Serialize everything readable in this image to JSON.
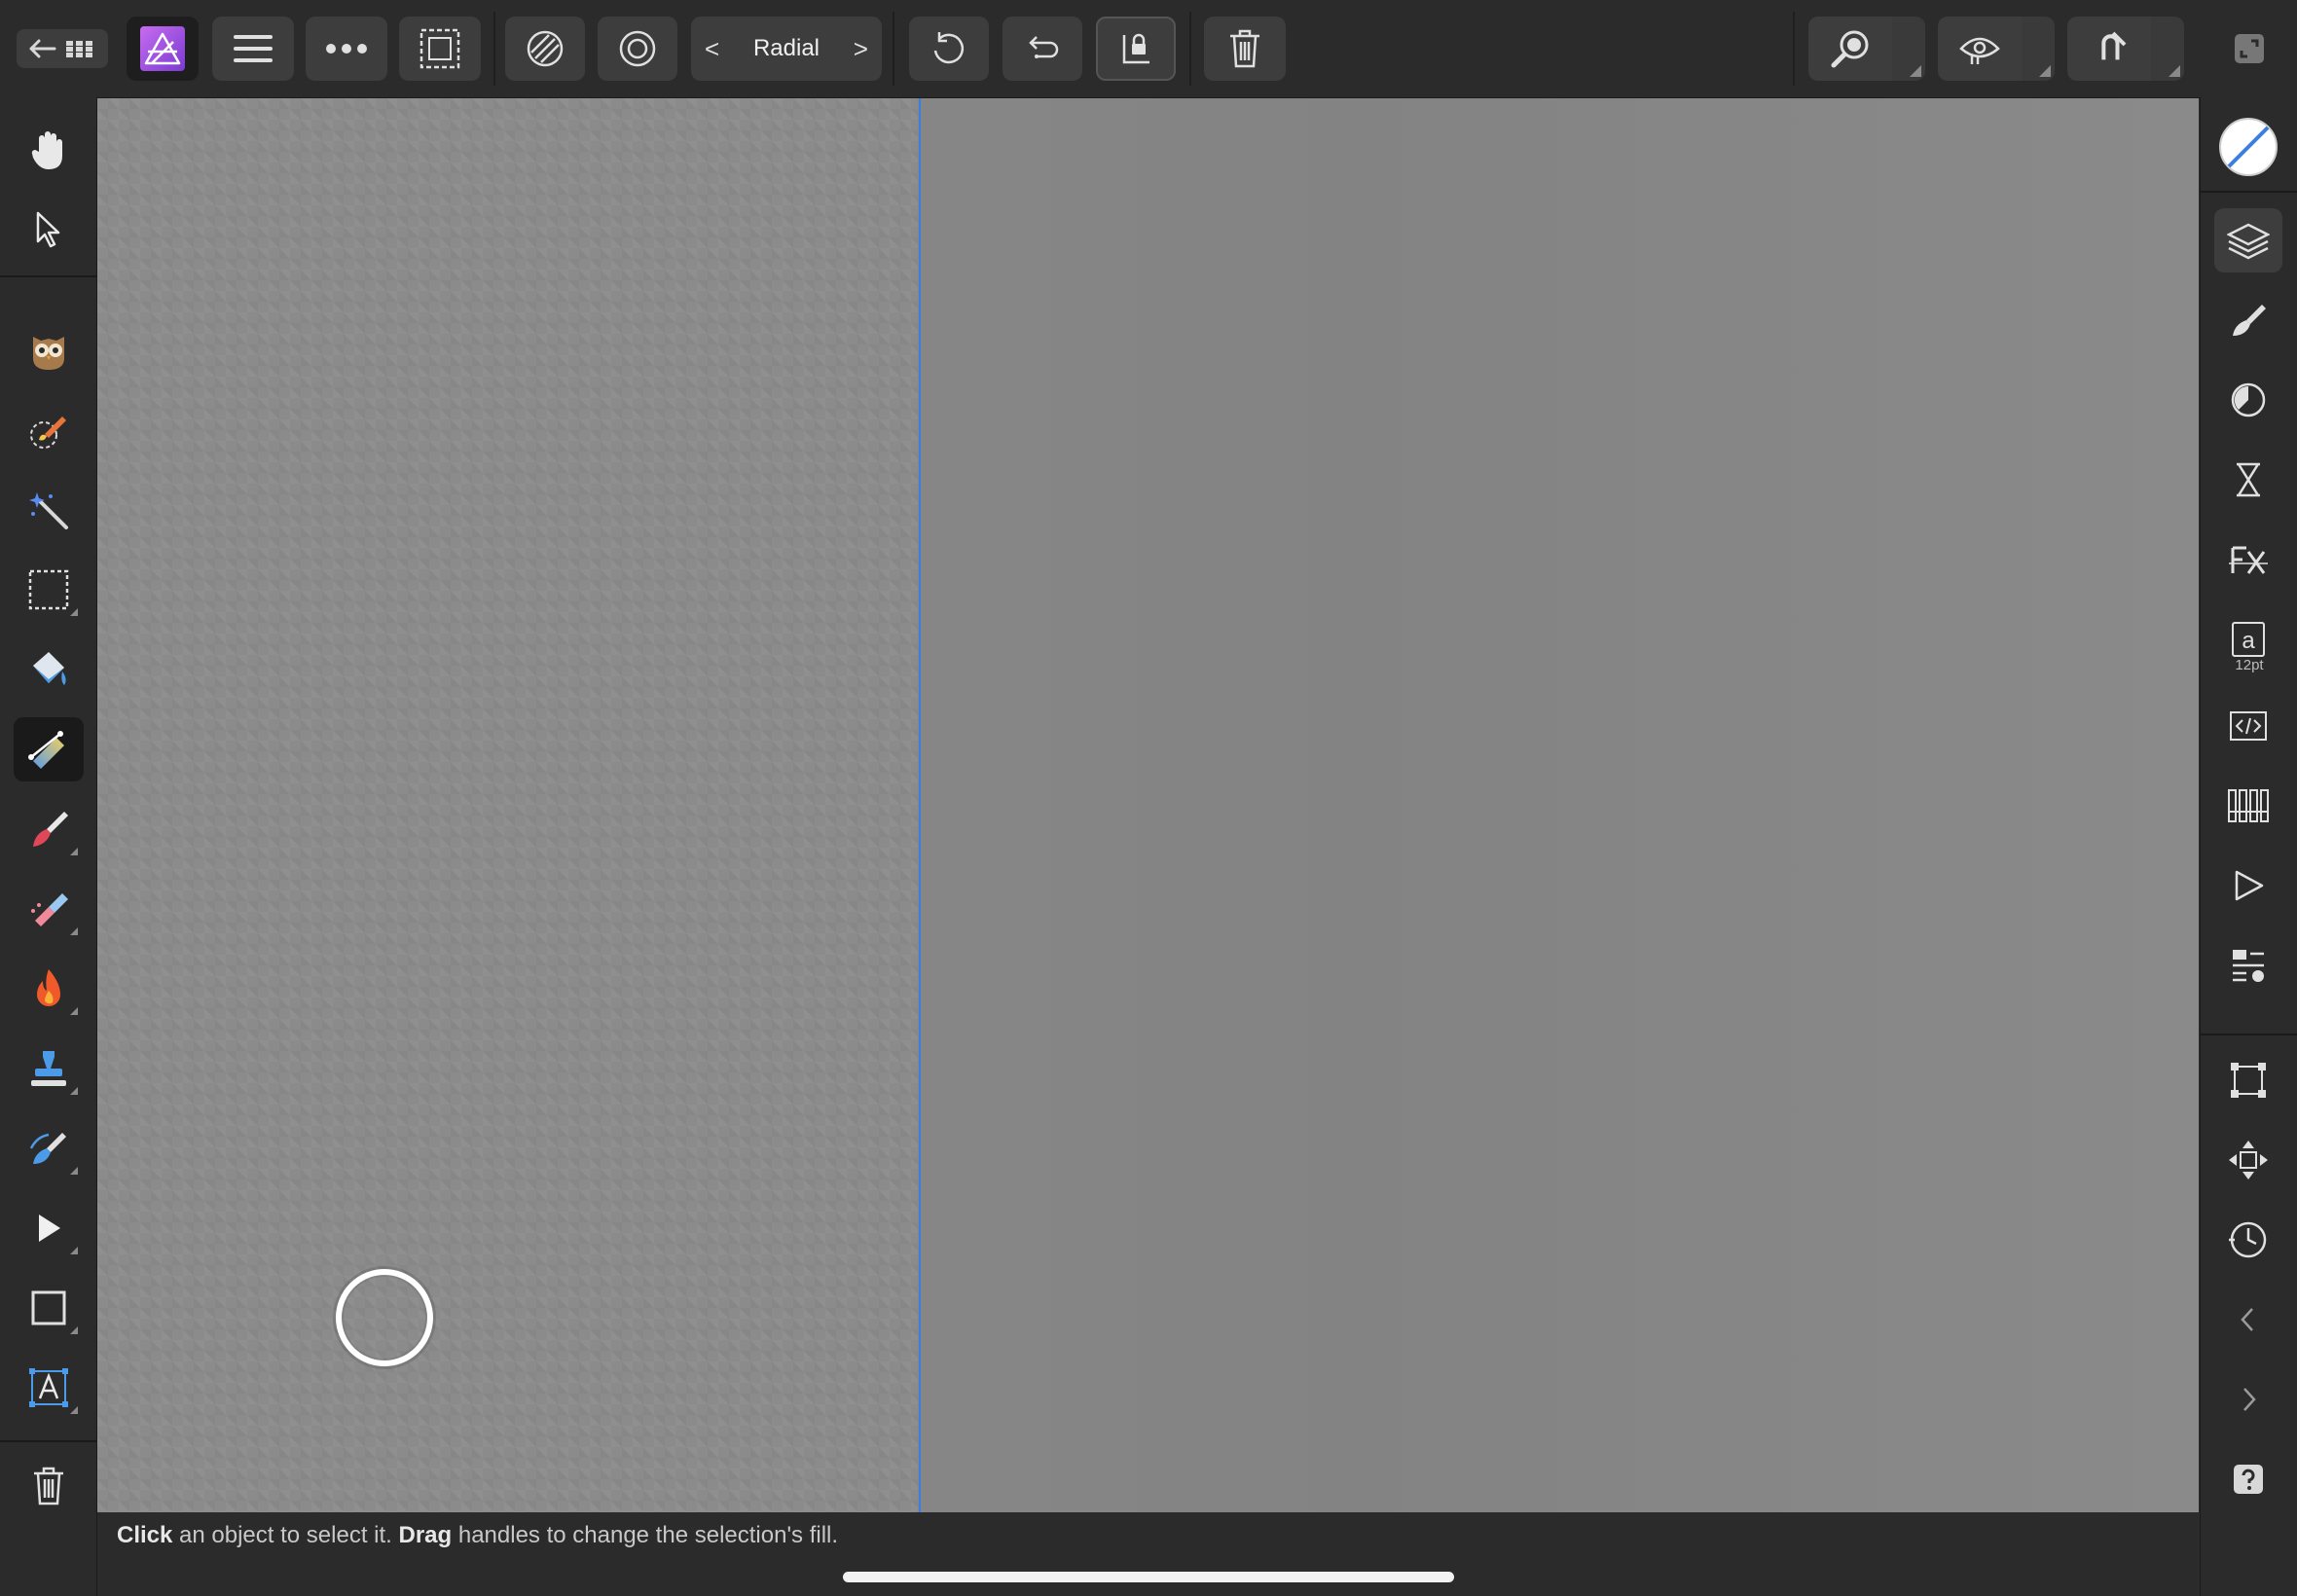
{
  "toolbar": {
    "mode_label": "Radial",
    "prev_symbol": "<",
    "next_symbol": ">"
  },
  "status": {
    "click_word": "Click",
    "click_rest": " an object to select it. ",
    "drag_word": "Drag",
    "drag_rest": " handles to change the selection's fill."
  },
  "right_panel": {
    "character_size": "12pt",
    "character_glyph": "a"
  },
  "left_tools": [
    "hand-tool",
    "move-tool",
    "export-persona-tool",
    "selection-brush-tool",
    "flood-select-tool",
    "marquee-tool",
    "flood-fill-tool",
    "gradient-tool",
    "paint-brush-tool",
    "inpainting-tool",
    "dodge-tool",
    "clone-tool",
    "smudge-tool",
    "node-tool",
    "rectangle-tool",
    "artistic-text-tool",
    "delete-tool"
  ],
  "colors": {
    "accent_blue": "#3a7fe0",
    "ui_background": "#2b2b2b",
    "button_background": "#3d3d3d",
    "affinity_purple": "#9b4fd6"
  }
}
